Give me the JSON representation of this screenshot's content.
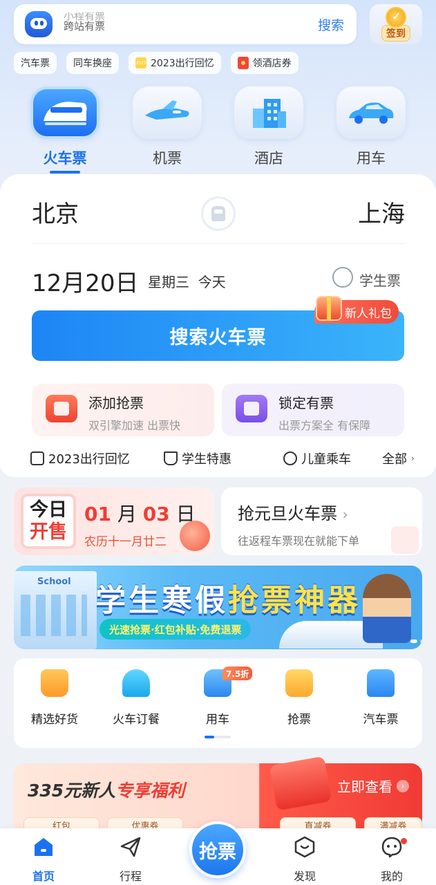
{
  "search": {
    "placeholder_top": "小程有票",
    "placeholder_bottom": "跨站有票",
    "button": "搜索"
  },
  "signin": {
    "label": "签到"
  },
  "chips": [
    "汽车票",
    "同车换座",
    "2023出行回忆",
    "领酒店券"
  ],
  "chip_calendar_text": "2023",
  "categories": [
    "火车票",
    "机票",
    "酒店",
    "用车"
  ],
  "trip": {
    "from": "北京",
    "to": "上海",
    "date": "12月20日",
    "weekday": "星期三",
    "day_tag": "今天",
    "student_label": "学生票"
  },
  "search_main": {
    "label": "搜索火车票",
    "badge": "新人礼包"
  },
  "features": [
    {
      "title": "添加抢票",
      "sub": "双引擎加速 出票快"
    },
    {
      "title": "锁定有票",
      "sub": "出票方案全 有保障"
    }
  ],
  "quick_links": [
    "2023出行回忆",
    "学生特惠",
    "儿童乘车",
    "全部"
  ],
  "today_card": {
    "line1": "今日",
    "line2": "开售",
    "month": "01",
    "month_unit": "月",
    "day": "03",
    "day_unit": "日",
    "lunar": "农历十一月廿二"
  },
  "newyear_card": {
    "title": "抢元旦火车票",
    "sub": "往返程车票现在就能下单"
  },
  "banner": {
    "title_part1": "学生寒假",
    "title_part2": "抢票神器",
    "sub": "光速抢票·红包补贴·免费退票"
  },
  "services": [
    "精选好货",
    "火车订餐",
    "用车",
    "抢票",
    "汽车票"
  ],
  "service_badge": "7.5折",
  "newcomer": {
    "title_a": "335元新人",
    "title_b": "专享福利",
    "cta": "立即查看",
    "coupons": [
      "红包",
      "优惠券",
      "直减券",
      "满减券"
    ]
  },
  "tabs": [
    "首页",
    "行程",
    "发现",
    "我的"
  ],
  "grab_button": "抢票",
  "colors": {
    "primary": "#1b72ee",
    "red": "#f03d35"
  }
}
